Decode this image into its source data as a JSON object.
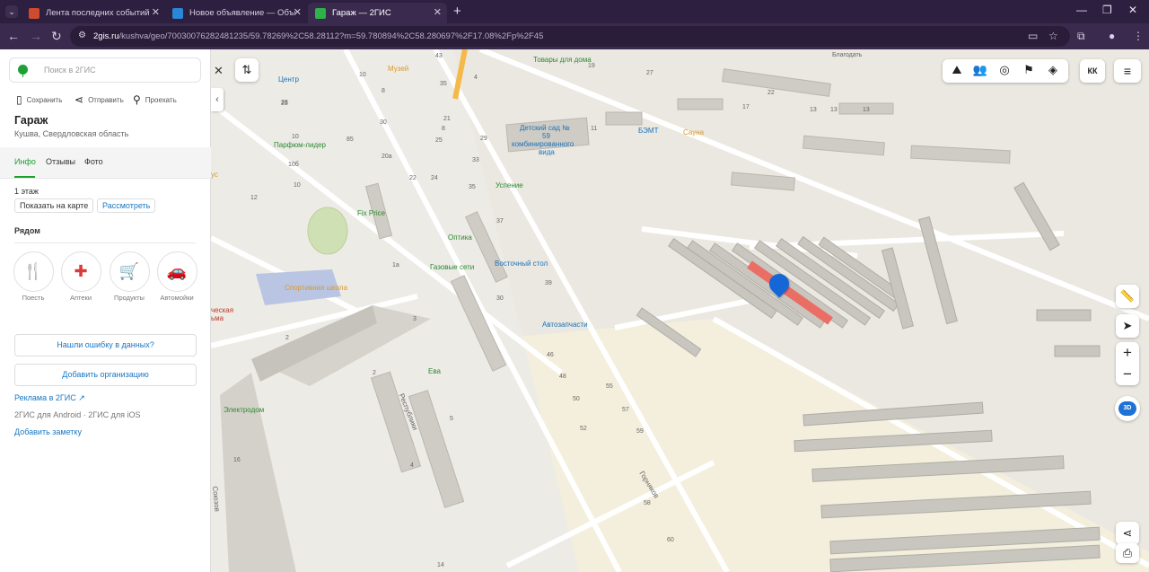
{
  "browser": {
    "tabs": [
      {
        "title": "Лента последних событий Ека",
        "favicon_color": "#d04a2d",
        "active": false
      },
      {
        "title": "Новое объявление — Объявл",
        "favicon_color": "#2a86d6",
        "active": false
      },
      {
        "title": "Гараж — 2ГИС",
        "favicon_color": "#2fb24a",
        "active": true
      }
    ],
    "url_main": "2gis.ru",
    "url_rest": "/kushva/geo/70030076282481235/59.78269%2C58.28112?m=59.780894%2C58.280697%2F17.08%2Fp%2F45"
  },
  "sidebar": {
    "search_placeholder": "Поиск в 2ГИС",
    "actions": {
      "save": "Сохранить",
      "send": "Отправить",
      "route": "Проехать"
    },
    "title": "Гараж",
    "subtitle": "Кушва, Свердловская область",
    "tabs": [
      "Инфо",
      "Отзывы",
      "Фото"
    ],
    "floor": "1 этаж",
    "show_on_map": "Показать на карте",
    "view": "Рассмотреть",
    "nearby_title": "Рядом",
    "nearby": [
      {
        "label": "Поесть",
        "icon": "fork-knife-icon"
      },
      {
        "label": "Аптеки",
        "icon": "pharmacy-icon"
      },
      {
        "label": "Продукты",
        "icon": "basket-icon"
      },
      {
        "label": "Автомойки",
        "icon": "car-wash-icon"
      }
    ],
    "report_error": "Нашли ошибку в данных?",
    "add_org": "Добавить организацию",
    "ads": "Реклама в 2ГИС ↗",
    "apps": "2ГИС для Android · 2ГИС для iOS",
    "add_note": "Добавить заметку"
  },
  "map": {
    "labels": [
      {
        "text": "Музей",
        "cls": "o"
      },
      {
        "text": "Центр",
        "cls": "b"
      },
      {
        "text": "Товары для дома",
        "cls": "g"
      },
      {
        "text": "Детский сад №",
        "cls": "b"
      },
      {
        "text": "59",
        "cls": "b"
      },
      {
        "text": "комбинированного",
        "cls": "b"
      },
      {
        "text": "вида",
        "cls": "b"
      },
      {
        "text": "БЭМТ",
        "cls": "b"
      },
      {
        "text": "Сауна",
        "cls": "o"
      },
      {
        "text": "Благодать",
        "cls": "gr"
      },
      {
        "text": "Парфюм-лидер",
        "cls": "g"
      },
      {
        "text": "Успение",
        "cls": "g"
      },
      {
        "text": "Fix Price",
        "cls": "g"
      },
      {
        "text": "Оптика",
        "cls": "g"
      },
      {
        "text": "Газовые сети",
        "cls": "g"
      },
      {
        "text": "Восточный стол",
        "cls": "b"
      },
      {
        "text": "Спортивная школа",
        "cls": "o"
      },
      {
        "text": "Автозапчасти",
        "cls": "b"
      },
      {
        "text": "Ева",
        "cls": "g"
      },
      {
        "text": "Электродом",
        "cls": "g"
      },
      {
        "text": "ческая",
        "cls": "r"
      },
      {
        "text": "ьма",
        "cls": "r"
      },
      {
        "text": "ус",
        "cls": "o"
      },
      {
        "text": "Республики",
        "cls": "gr"
      },
      {
        "text": "Горняков",
        "cls": "gr"
      },
      {
        "text": "Союзов",
        "cls": "gr"
      }
    ],
    "numbers": [
      "43",
      "4",
      "23",
      "35",
      "19",
      "27",
      "8",
      "8",
      "10",
      "11",
      "13",
      "13",
      "21",
      "25",
      "25",
      "29",
      "30",
      "33",
      "85",
      "10б",
      "20а",
      "10",
      "10",
      "22",
      "24",
      "12",
      "35",
      "37",
      "39",
      "1а",
      "2",
      "3",
      "2",
      "5",
      "4",
      "16",
      "30",
      "46",
      "48",
      "50",
      "52",
      "55",
      "57",
      "59",
      "58",
      "60",
      "14",
      "22",
      "17",
      "13"
    ],
    "toolbar_icons": [
      "route-icon",
      "people-icon",
      "compass-icon",
      "signs-icon",
      "layers-icon"
    ],
    "user_initials": "КК",
    "btn_3d": "3D"
  }
}
